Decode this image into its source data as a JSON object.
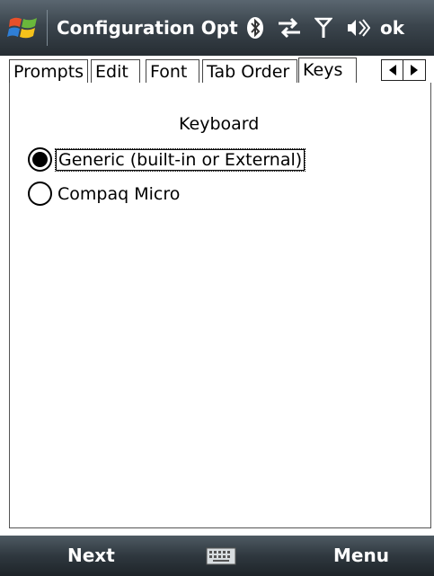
{
  "titlebar": {
    "title": "Configuration Opti",
    "ok_label": "ok",
    "icons": [
      "windows-start-icon",
      "bluetooth-icon",
      "connectivity-icon",
      "signal-icon",
      "volume-icon"
    ]
  },
  "tabs": [
    {
      "label": "Prompts",
      "active": false
    },
    {
      "label": "Edit",
      "active": false
    },
    {
      "label": "Font",
      "active": false
    },
    {
      "label": "Tab Order",
      "active": false
    },
    {
      "label": "Keys",
      "active": true
    }
  ],
  "panel": {
    "group_label": "Keyboard",
    "options": [
      {
        "label": "Generic (built-in or External)",
        "selected": true
      },
      {
        "label": "Compaq Micro",
        "selected": false
      }
    ]
  },
  "bottombar": {
    "left_softkey": "Next",
    "right_softkey": "Menu",
    "center_icon": "keyboard-icon"
  },
  "colors": {
    "titlebar": "#3b454d",
    "bottombar": "#2f383f"
  }
}
